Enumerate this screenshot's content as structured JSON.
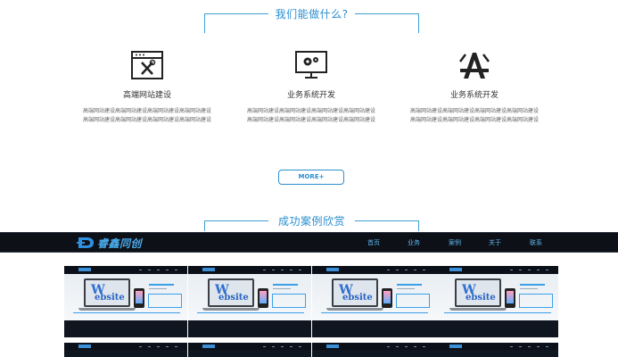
{
  "section1": {
    "title": "我们能做什么?"
  },
  "services": [
    {
      "icon": "browser-tools-icon",
      "name": "高端网站建设",
      "desc": "高端网站建设高端网站建设高端网站建设高端网站建设高端网站建设高端网站建设高端网站建设高端网站建设"
    },
    {
      "icon": "monitor-gears-icon",
      "name": "业务系统开发",
      "desc": "高端网站建设高端网站建设高端网站建设高端网站建设高端网站建设高端网站建设高端网站建设高端网站建设"
    },
    {
      "icon": "app-store-icon",
      "name": "业务系统开发",
      "desc": "高端网站建设高端网站建设高端网站建设高端网站建设高端网站建设高端网站建设高端网站建设高端网站建设"
    }
  ],
  "more_button": {
    "label": "MORE+"
  },
  "section2": {
    "title": "成功案例欣赏"
  },
  "navbar": {
    "brand": "睿鑫同创",
    "items": [
      "首页",
      "业务",
      "案例",
      "关于",
      "联系"
    ]
  },
  "colors": {
    "accent": "#2a8fd0",
    "nav_bg": "#0d1117",
    "nav_text": "#5fb7ee"
  }
}
